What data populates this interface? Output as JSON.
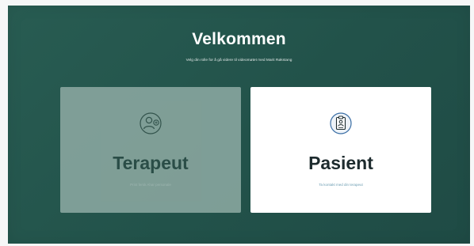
{
  "page": {
    "title": "Velkommen",
    "subtitle": "Velg din rolle for å gå videre til videomøtet med Marit Røkstang"
  },
  "roles": [
    {
      "label": "Terapeut",
      "description": "Print fersk Ahar personale",
      "icon": "user-add-icon",
      "state": "disabled"
    },
    {
      "label": "Pasient",
      "description": "Ta kontakt med din terapeut",
      "icon": "clipboard-user-icon",
      "state": "active"
    }
  ],
  "colors": {
    "background": "#245549",
    "card_disabled": "#84a29b",
    "card_active": "#ffffff",
    "accent": "#3a6ea5",
    "heading_dark": "#1d2b2e"
  }
}
